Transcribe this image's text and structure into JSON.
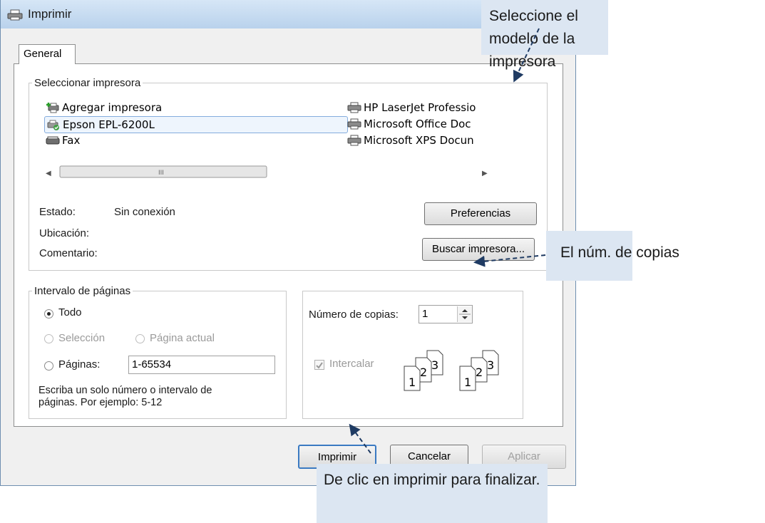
{
  "window": {
    "title": "Imprimir"
  },
  "tabs": [
    {
      "label": "General"
    }
  ],
  "select_printer": {
    "legend": "Seleccionar impresora",
    "printers": [
      {
        "name": "Agregar impresora",
        "icon": "add-printer-icon"
      },
      {
        "name": "Epson EPL-6200L",
        "icon": "printer-offline-icon",
        "selected": true
      },
      {
        "name": "Fax",
        "icon": "fax-icon"
      },
      {
        "name": "HP LaserJet Professio",
        "icon": "printer-icon"
      },
      {
        "name": "Microsoft Office Doc",
        "icon": "printer-icon"
      },
      {
        "name": "Microsoft XPS Docun",
        "icon": "printer-icon"
      }
    ],
    "status_label": "Estado:",
    "status_value": "Sin conexión",
    "location_label": "Ubicación:",
    "comment_label": "Comentario:",
    "preferences_button": "Preferencias",
    "find_printer_button": "Buscar impresora..."
  },
  "page_range": {
    "legend": "Intervalo de páginas",
    "all": "Todo",
    "selection": "Selección",
    "current_page": "Página actual",
    "pages": "Páginas:",
    "pages_value": "1-65534",
    "hint": "Escriba un solo número o intervalo de páginas. Por ejemplo: 5-12",
    "selected_option": "Todo"
  },
  "copies": {
    "label": "Número de copias:",
    "value": "1",
    "collate_label": "Intercalar",
    "collate_checked": true
  },
  "buttons": {
    "print": "Imprimir",
    "cancel": "Cancelar",
    "apply": "Aplicar"
  },
  "callouts": {
    "printer_model": "Seleccione el modelo de la impresora",
    "copies": "El núm.  de copias",
    "print": "De clic en imprimir para finalizar."
  },
  "colors": {
    "callout_bg": "#dce6f2",
    "arrow": "#1f3b63",
    "selection_border": "#84acdd"
  }
}
